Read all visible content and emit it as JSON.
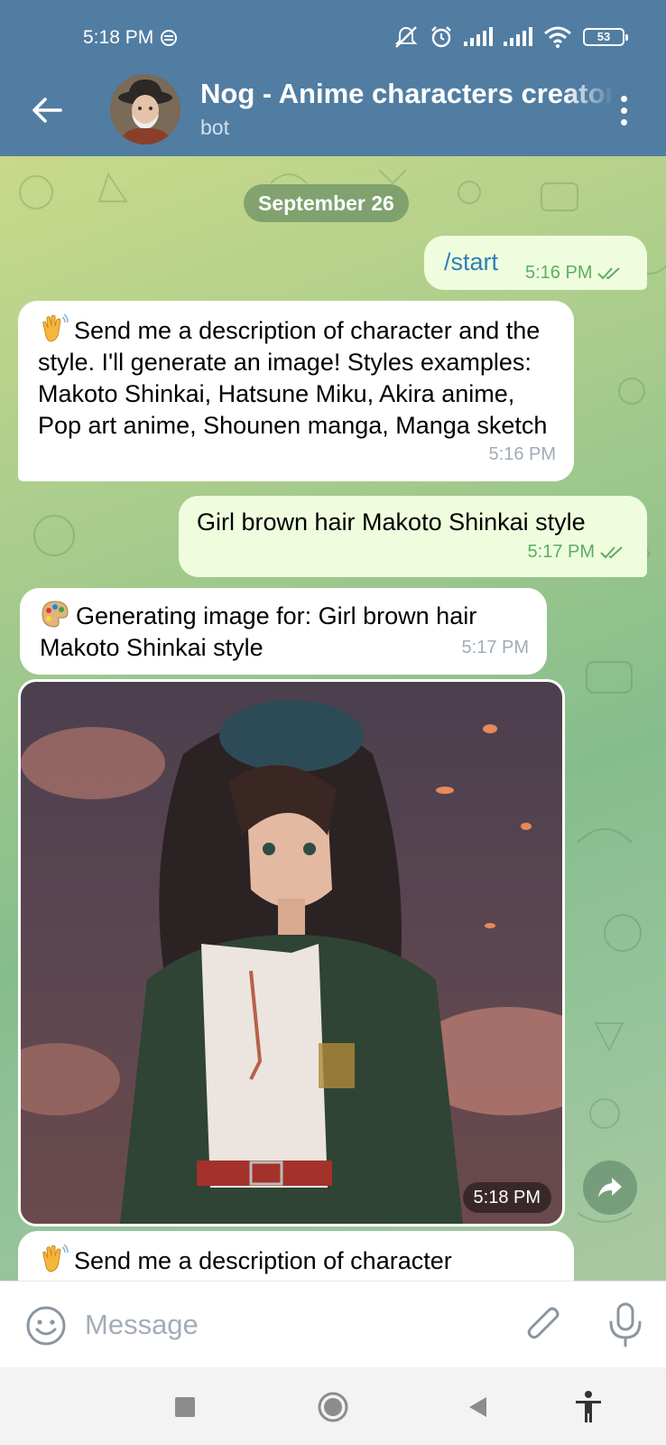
{
  "status_bar": {
    "time": "5:18 PM",
    "battery": "53",
    "icons": [
      "data-saver-icon",
      "mute-icon",
      "alarm-icon",
      "signal-icon",
      "signal-icon",
      "wifi-icon",
      "battery-icon"
    ]
  },
  "header": {
    "title": "Nog - Anime characters creator",
    "subtitle": "bot",
    "back_icon": "back-arrow-icon",
    "menu_icon": "more-vertical-icon"
  },
  "chat": {
    "date_separator": "September 26",
    "messages": [
      {
        "direction": "out",
        "text": "/start",
        "time": "5:16 PM",
        "status": "read"
      },
      {
        "direction": "in",
        "emoji": "waving-hand",
        "text": "Send me a description of character and the style. I'll generate an image! Styles examples: Makoto Shinkai, Hatsune Miku, Akira anime, Pop art anime, Shounen manga, Manga sketch",
        "time": "5:16 PM"
      },
      {
        "direction": "out",
        "text": "Girl brown hair Makoto Shinkai style",
        "time": "5:17 PM",
        "status": "read"
      },
      {
        "direction": "in",
        "emoji": "artist-palette",
        "text": "Generating image for: Girl brown hair Makoto Shinkai style",
        "time": "5:17 PM"
      },
      {
        "direction": "in",
        "type": "photo",
        "time": "5:18 PM"
      },
      {
        "direction": "in",
        "emoji": "waving-hand",
        "text": "Send me a description of character"
      }
    ]
  },
  "input": {
    "placeholder": "Message",
    "value": ""
  },
  "colors": {
    "header": "#517da2",
    "outgoing_bubble": "#effdde",
    "incoming_bubble": "#ffffff",
    "link": "#2e7fb8",
    "read_tick": "#5cad64"
  }
}
